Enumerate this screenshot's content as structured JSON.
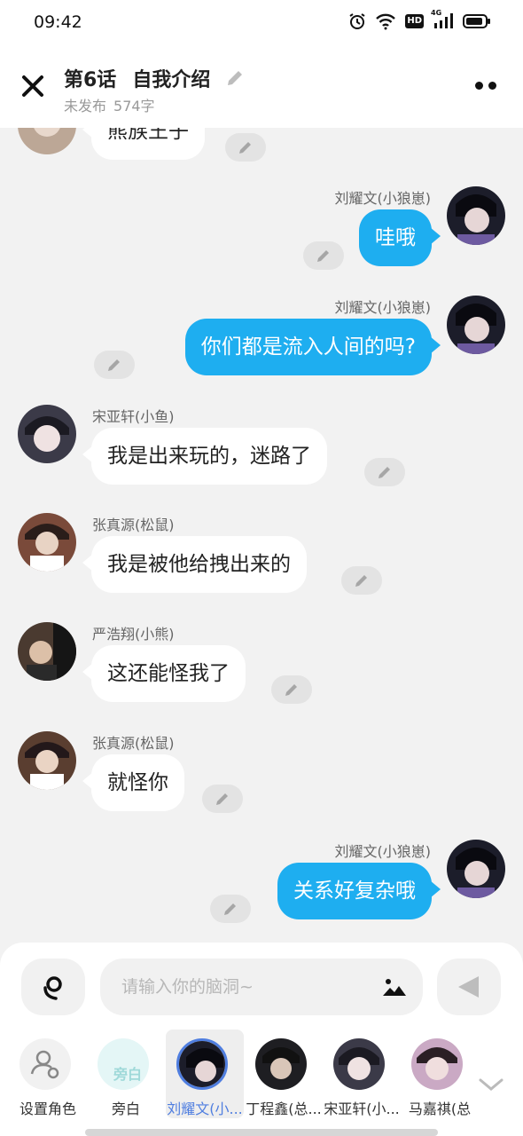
{
  "status": {
    "time": "09:42",
    "network": "4G",
    "hd": "HD"
  },
  "header": {
    "episode": "第6话",
    "name": "自我介绍",
    "publish_state": "未发布",
    "word_count": "574字"
  },
  "messages": [
    {
      "side": "left",
      "name": "",
      "text": "熊族王子"
    },
    {
      "side": "right",
      "name": "刘耀文(小狼崽)",
      "text": "哇哦"
    },
    {
      "side": "right",
      "name": "刘耀文(小狼崽)",
      "text": "你们都是流入人间的吗?"
    },
    {
      "side": "left",
      "name": "宋亚轩(小鱼)",
      "text": "我是出来玩的，迷路了"
    },
    {
      "side": "left",
      "name": "张真源(松鼠)",
      "text": "我是被他给拽出来的"
    },
    {
      "side": "left",
      "name": "严浩翔(小熊)",
      "text": "这还能怪我了"
    },
    {
      "side": "left",
      "name": "张真源(松鼠)",
      "text": "就怪你"
    },
    {
      "side": "right",
      "name": "刘耀文(小狼崽)",
      "text": "关系好复杂哦"
    }
  ],
  "composer": {
    "placeholder": "请输入你的脑洞~"
  },
  "roles": [
    {
      "label": "设置角色",
      "badge": ""
    },
    {
      "label": "旁白",
      "badge": "旁白"
    },
    {
      "label": "刘耀文(小...",
      "badge": ""
    },
    {
      "label": "丁程鑫(总...",
      "badge": ""
    },
    {
      "label": "宋亚轩(小...",
      "badge": ""
    },
    {
      "label": "马嘉祺(总",
      "badge": ""
    }
  ],
  "colors": {
    "accent": "#1eaef0",
    "selected": "#4f7ee0"
  }
}
